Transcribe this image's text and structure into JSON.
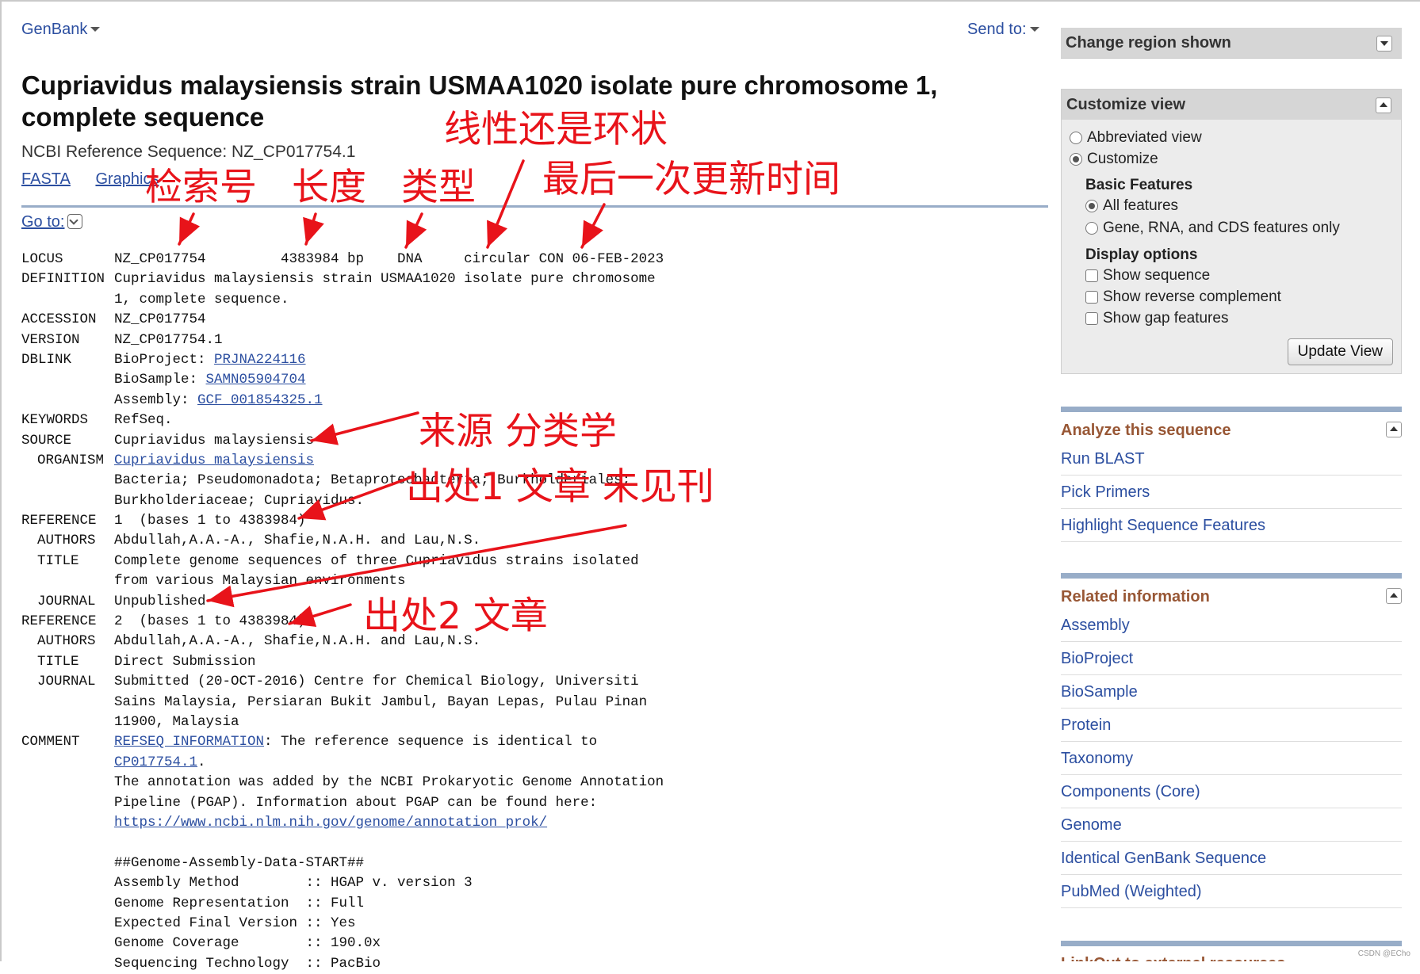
{
  "topbar": {
    "db_menu": "GenBank",
    "send_to": "Send to:"
  },
  "record": {
    "title": "Cupriavidus malaysiensis strain USMAA1020 isolate pure chromosome 1, complete sequence",
    "refseq_line": "NCBI Reference Sequence: NZ_CP017754.1",
    "links": [
      "FASTA",
      "Graphics"
    ],
    "goto": "Go to:"
  },
  "flatfile": [
    {
      "key": "LOCUS",
      "sub": false,
      "value": "NZ_CP017754         4383984 bp    DNA     circular CON 06-FEB-2023"
    },
    {
      "key": "DEFINITION",
      "sub": false,
      "value": "Cupriavidus malaysiensis strain USMAA1020 isolate pure chromosome"
    },
    {
      "key": "",
      "sub": false,
      "value": "1, complete sequence."
    },
    {
      "key": "ACCESSION",
      "sub": false,
      "value": "NZ_CP017754"
    },
    {
      "key": "VERSION",
      "sub": false,
      "value": "NZ_CP017754.1"
    },
    {
      "key": "DBLINK",
      "sub": false,
      "value": "BioProject: ",
      "link": "PRJNA224116"
    },
    {
      "key": "",
      "sub": false,
      "value": "BioSample: ",
      "link": "SAMN05904704"
    },
    {
      "key": "",
      "sub": false,
      "value": "Assembly: ",
      "link": "GCF_001854325.1"
    },
    {
      "key": "KEYWORDS",
      "sub": false,
      "value": "RefSeq."
    },
    {
      "key": "SOURCE",
      "sub": false,
      "value": "Cupriavidus malaysiensis"
    },
    {
      "key": "ORGANISM",
      "sub": true,
      "value": "",
      "link": "Cupriavidus malaysiensis"
    },
    {
      "key": "",
      "sub": false,
      "value": "Bacteria; Pseudomonadota; Betaproteobacteria; Burkholderiales;"
    },
    {
      "key": "",
      "sub": false,
      "value": "Burkholderiaceae; Cupriavidus."
    },
    {
      "key": "REFERENCE",
      "sub": false,
      "value": "1  (bases 1 to 4383984)"
    },
    {
      "key": "AUTHORS",
      "sub": true,
      "value": "Abdullah,A.A.-A., Shafie,N.A.H. and Lau,N.S."
    },
    {
      "key": "TITLE",
      "sub": true,
      "value": "Complete genome sequences of three Cupriavidus strains isolated"
    },
    {
      "key": "",
      "sub": false,
      "value": "from various Malaysian environments"
    },
    {
      "key": "JOURNAL",
      "sub": true,
      "value": "Unpublished"
    },
    {
      "key": "REFERENCE",
      "sub": false,
      "value": "2  (bases 1 to 4383984)"
    },
    {
      "key": "AUTHORS",
      "sub": true,
      "value": "Abdullah,A.A.-A., Shafie,N.A.H. and Lau,N.S."
    },
    {
      "key": "TITLE",
      "sub": true,
      "value": "Direct Submission"
    },
    {
      "key": "JOURNAL",
      "sub": true,
      "value": "Submitted (20-OCT-2016) Centre for Chemical Biology, Universiti"
    },
    {
      "key": "",
      "sub": false,
      "value": "Sains Malaysia, Persiaran Bukit Jambul, Bayan Lepas, Pulau Pinan"
    },
    {
      "key": "",
      "sub": false,
      "value": "11900, Malaysia"
    },
    {
      "key": "COMMENT",
      "sub": false,
      "value": "",
      "link": "REFSEQ INFORMATION",
      "after": ": The reference sequence is identical to"
    },
    {
      "key": "",
      "sub": false,
      "value": "",
      "link": "CP017754.1",
      "after": "."
    },
    {
      "key": "",
      "sub": false,
      "value": "The annotation was added by the NCBI Prokaryotic Genome Annotation"
    },
    {
      "key": "",
      "sub": false,
      "value": "Pipeline (PGAP). Information about PGAP can be found here:"
    },
    {
      "key": "",
      "sub": false,
      "value": "",
      "link": "https://www.ncbi.nlm.nih.gov/genome/annotation_prok/"
    },
    {
      "key": "",
      "sub": false,
      "value": ""
    },
    {
      "key": "",
      "sub": false,
      "value": "##Genome-Assembly-Data-START##"
    },
    {
      "key": "",
      "sub": false,
      "value": "Assembly Method        :: HGAP v. version 3"
    },
    {
      "key": "",
      "sub": false,
      "value": "Genome Representation  :: Full"
    },
    {
      "key": "",
      "sub": false,
      "value": "Expected Final Version :: Yes"
    },
    {
      "key": "",
      "sub": false,
      "value": "Genome Coverage        :: 190.0x"
    },
    {
      "key": "",
      "sub": false,
      "value": "Sequencing Technology  :: PacBio"
    }
  ],
  "sidebar": {
    "change_region": "Change region shown",
    "customize": {
      "title": "Customize view",
      "abbreviated": "Abbreviated view",
      "customize": "Customize",
      "basic_features": "Basic Features",
      "all_features": "All features",
      "gene_rna_cds": "Gene, RNA, and CDS features only",
      "display_options": "Display options",
      "show_sequence": "Show sequence",
      "show_reverse": "Show reverse complement",
      "show_gap": "Show gap features",
      "update_button": "Update View"
    },
    "analyze": {
      "title": "Analyze this sequence",
      "items": [
        "Run BLAST",
        "Pick Primers",
        "Highlight Sequence Features"
      ]
    },
    "related": {
      "title": "Related information",
      "items": [
        "Assembly",
        "BioProject",
        "BioSample",
        "Protein",
        "Taxonomy",
        "Components (Core)",
        "Genome",
        "Identical GenBank Sequence",
        "PubMed (Weighted)"
      ]
    },
    "linkout": "LinkOut to external resources"
  },
  "annotations": {
    "accession": "检索号",
    "length": "长度",
    "type": "类型",
    "topology": "线性还是环状",
    "update": "最后一次更新时间",
    "source": "来源 分类学",
    "ref1": "出处1 文章 未见刊",
    "ref2": "出处2 文章"
  },
  "colors": {
    "link": "#2b4ea0",
    "annotation": "#e8131a",
    "portlet_title": "#985735",
    "divider": "#98adc8"
  },
  "watermark": "CSDN @ECho"
}
